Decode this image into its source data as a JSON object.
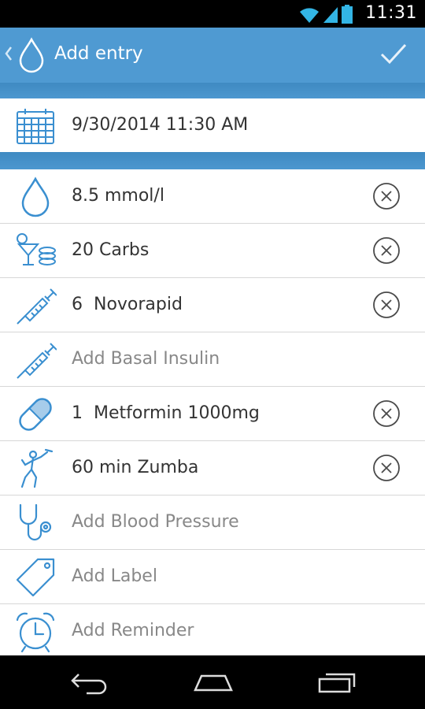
{
  "status_bar": {
    "time": "11:31"
  },
  "action_bar": {
    "title": "Add entry"
  },
  "date_row": {
    "datetime": "9/30/2014 11:30 AM"
  },
  "entries": [
    {
      "text": "8.5 mmol/l",
      "icon": "drop-icon"
    },
    {
      "text": "20 Carbs",
      "icon": "food-icon"
    },
    {
      "text": "6  Novorapid",
      "icon": "syringe-icon"
    },
    {
      "text": "Add Basal Insulin",
      "icon": "syringe-icon"
    },
    {
      "text": "1  Metformin 1000mg",
      "icon": "pill-icon"
    },
    {
      "text": "60 min Zumba",
      "icon": "exercise-icon"
    },
    {
      "text": "Add Blood Pressure",
      "icon": "stethoscope-icon"
    },
    {
      "text": "Add Label",
      "icon": "tag-icon"
    },
    {
      "text": "Add Reminder",
      "icon": "alarm-clock-icon"
    }
  ],
  "colors": {
    "accent": "#4f9ad2",
    "icon_blue": "#3a8fd0"
  }
}
